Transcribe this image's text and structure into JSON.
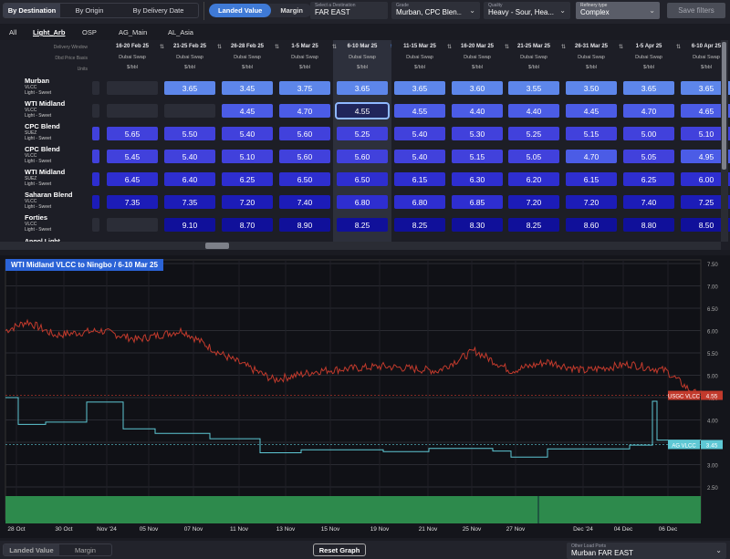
{
  "top": {
    "tabs": [
      "By Destination",
      "By Origin",
      "By Delivery Date"
    ],
    "mode": [
      "Landed Value",
      "Margin"
    ],
    "destination": {
      "label": "Select a Destination",
      "value": "FAR EAST"
    },
    "grade": {
      "label": "Grade",
      "value": "Murban, CPC Blen..."
    },
    "quality": {
      "label": "Quality",
      "value": "Heavy - Sour, Hea..."
    },
    "refinery": {
      "label": "Refinery type",
      "value": "Complex"
    },
    "save": "Save filters"
  },
  "subtabs": [
    "All",
    "Light_Arb",
    "OSP",
    "AG_Main",
    "AL_Asia"
  ],
  "grid": {
    "rowlabels": [
      "Delivery Window",
      "Dbd Price Basis",
      "Units"
    ],
    "columns": [
      "16-20 Feb 25",
      "21-25 Feb 25",
      "26-28 Feb 25",
      "1-5 Mar 25",
      "6-10 Mar 25",
      "11-15 Mar 25",
      "16-20 Mar 25",
      "21-25 Mar 25",
      "26-31 Mar 25",
      "1-5 Apr 25",
      "6-10 Apr 25"
    ],
    "basis": "Dubai Swap",
    "units": "$/bbl",
    "rows": [
      {
        "name": "Murban",
        "ship": "VLCC",
        "q": "Light - Sweet",
        "vals": [
          "",
          "3.65",
          "3.45",
          "3.75",
          "3.65",
          "3.65",
          "3.60",
          "3.55",
          "3.50",
          "3.65",
          "3.65"
        ]
      },
      {
        "name": "WTI Midland",
        "ship": "VLCC",
        "q": "Light - Sweet",
        "vals": [
          "",
          "",
          "4.45",
          "4.70",
          "4.55",
          "4.55",
          "4.40",
          "4.40",
          "4.45",
          "4.70",
          "4.65"
        ]
      },
      {
        "name": "CPC Blend",
        "ship": "SUEZ",
        "q": "Light - Sweet",
        "vals": [
          "5.65",
          "5.50",
          "5.40",
          "5.60",
          "5.25",
          "5.40",
          "5.30",
          "5.25",
          "5.15",
          "5.00",
          "5.10"
        ]
      },
      {
        "name": "CPC Blend",
        "ship": "VLCC",
        "q": "Light - Sweet",
        "vals": [
          "5.45",
          "5.40",
          "5.10",
          "5.60",
          "5.60",
          "5.40",
          "5.15",
          "5.05",
          "4.70",
          "5.05",
          "4.95"
        ]
      },
      {
        "name": "WTI Midland",
        "ship": "SUEZ",
        "q": "Light - Sweet",
        "vals": [
          "6.45",
          "6.40",
          "6.25",
          "6.50",
          "6.50",
          "6.15",
          "6.30",
          "6.20",
          "6.15",
          "6.25",
          "6.00"
        ]
      },
      {
        "name": "Saharan Blend",
        "ship": "VLCC",
        "q": "Light - Sweet",
        "vals": [
          "7.35",
          "7.35",
          "7.20",
          "7.40",
          "6.80",
          "6.80",
          "6.85",
          "7.20",
          "7.20",
          "7.40",
          "7.25"
        ]
      },
      {
        "name": "Forties",
        "ship": "VLCC",
        "q": "Light - Sweet",
        "vals": [
          "",
          "9.10",
          "8.70",
          "8.90",
          "8.25",
          "8.25",
          "8.30",
          "8.25",
          "8.60",
          "8.80",
          "8.50"
        ]
      }
    ],
    "partial": "Angol Light"
  },
  "chart": {
    "title": "WTI Midland VLCC to Ningbo / 6-10 Mar 25",
    "yticks": [
      "7.50",
      "7.00",
      "6.50",
      "6.00",
      "5.50",
      "5.00",
      "4.50",
      "4.00",
      "3.50",
      "3.00",
      "2.50"
    ],
    "xticks": [
      "28 Oct",
      "30 Oct",
      "Nov '24",
      "05 Nov",
      "07 Nov",
      "11 Nov",
      "13 Nov",
      "15 Nov",
      "19 Nov",
      "21 Nov",
      "25 Nov",
      "27 Nov",
      "Dec '24",
      "04 Dec",
      "06 Dec"
    ],
    "tags": [
      {
        "name": "USGC VLCC",
        "value": "4.55",
        "color": "#c23a2c"
      },
      {
        "name": "AG VLCC",
        "value": "3.45",
        "color": "#5ec8d4"
      }
    ]
  },
  "bottom": {
    "tabs": [
      "Landed Value",
      "Margin"
    ],
    "reset": "Reset Graph",
    "ports": {
      "label": "Other Load Ports",
      "value": "Murban FAR EAST"
    }
  }
}
